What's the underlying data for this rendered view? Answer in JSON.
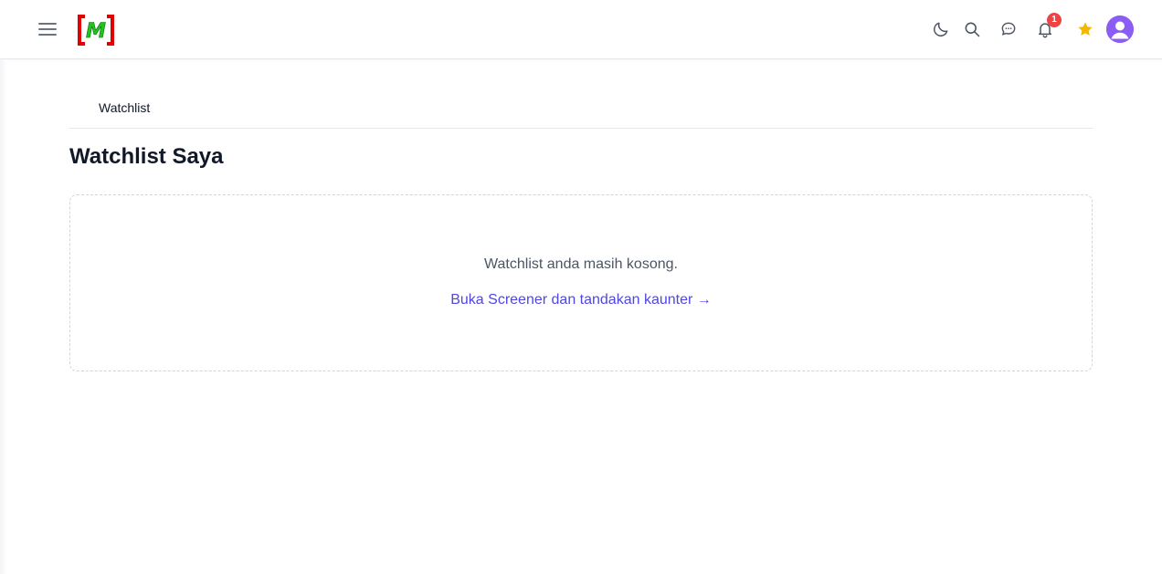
{
  "header": {
    "menu_icon": "hamburger-menu-icon",
    "logo_letter": "M",
    "icons": [
      "moon-icon",
      "search-icon",
      "chat-icon",
      "bell-icon",
      "star-icon",
      "user-avatar-icon"
    ],
    "notification_count": "1",
    "colors": {
      "logo_bracket": "#e00000",
      "logo_letter": "#22c31e",
      "badge": "#ef4444",
      "star": "#f5b800",
      "avatar": "#8b5cf6"
    }
  },
  "breadcrumb": {
    "items": [
      {
        "label": "Watchlist"
      }
    ]
  },
  "page": {
    "title": "Watchlist Saya"
  },
  "empty_state": {
    "message": "Watchlist anda masih kosong.",
    "link_label": "Buka Screener dan tandakan kaunter →",
    "link_color": "#4f46e5"
  }
}
